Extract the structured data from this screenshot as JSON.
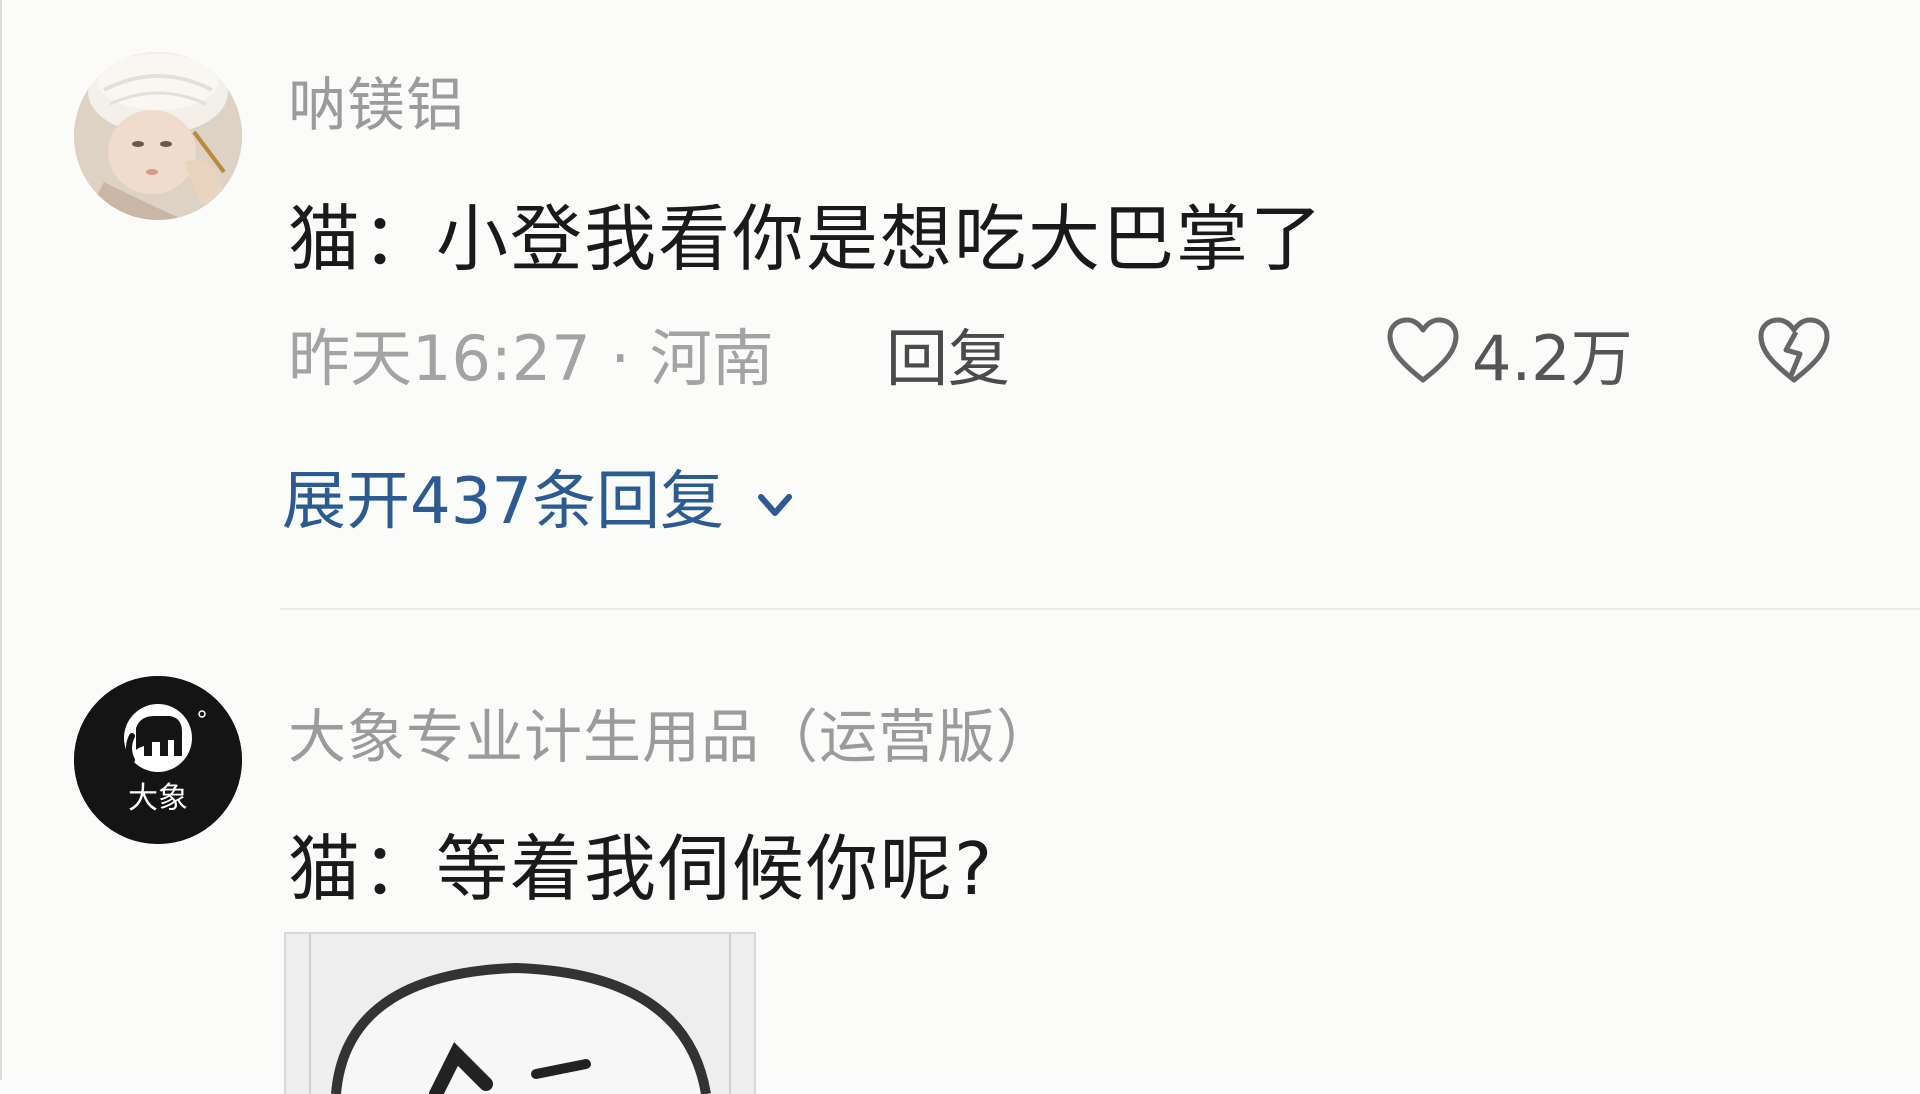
{
  "comments": [
    {
      "username": "呐镁铝",
      "content": "猫：小登我看你是想吃大巴掌了",
      "meta": "昨天16:27 · 河南",
      "reply_label": "回复",
      "like_count": "4.2万",
      "expand_label": "展开437条回复",
      "avatar_icon": "baby-photo-avatar"
    },
    {
      "username": "大象专业计生用品（运营版）",
      "content": "猫：等着我伺候你呢?",
      "avatar_logo_text": "大象",
      "avatar_icon": "elephant-logo-avatar",
      "image_icon": "meme-image-thumbnail"
    }
  ],
  "colors": {
    "username": "#9b9b9b",
    "content": "#1a1a1a",
    "meta": "#a3a3a3",
    "link": "#2c5b92",
    "background": "#fbfbfa"
  }
}
